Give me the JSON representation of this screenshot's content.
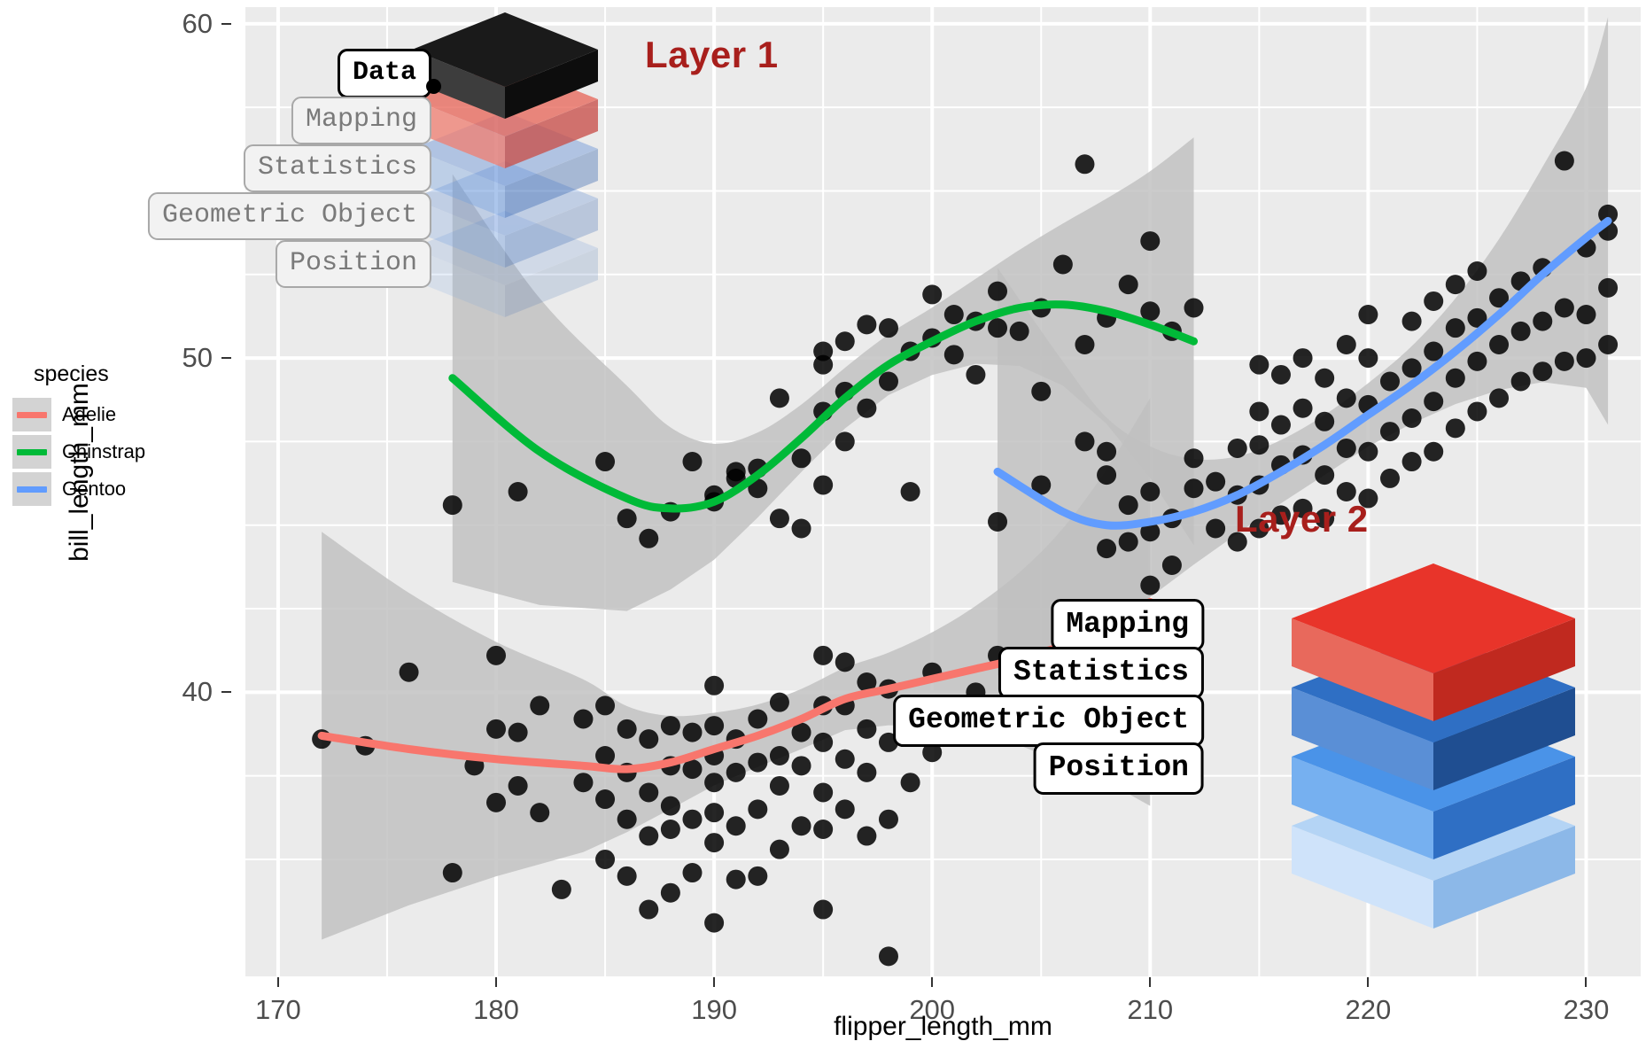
{
  "chart_data": {
    "type": "scatter",
    "title": "",
    "xlabel": "flipper_length_mm",
    "ylabel": "bill_length_mm",
    "xlim": [
      168.5,
      232.5
    ],
    "ylim": [
      31.5,
      60.5
    ],
    "xticks": [
      "170",
      "180",
      "190",
      "200",
      "210",
      "220",
      "230"
    ],
    "xtick_values": [
      170,
      180,
      190,
      200,
      210,
      220,
      230
    ],
    "yticks": [
      "60",
      "50",
      "40"
    ],
    "ytick_values": [
      60,
      50,
      40
    ],
    "grid": true,
    "panel_background": "#ebebeb",
    "grid_color": "#ffffff",
    "point_color": "#000000",
    "point_alpha": 0.85,
    "se_band_color": "#bfbfbf",
    "legend_title": "species",
    "legend_position": "left",
    "series": [
      {
        "name": "Adelie",
        "color": "#f8766d",
        "smooth_x": [
          172,
          176,
          180,
          184,
          186,
          188,
          190,
          192,
          194,
          196,
          198,
          200,
          202,
          204,
          206,
          208,
          210
        ],
        "smooth_y": [
          38.7,
          38.3,
          38.0,
          37.8,
          37.7,
          37.9,
          38.3,
          38.7,
          39.2,
          39.8,
          40.1,
          40.4,
          40.7,
          41.0,
          41.4,
          42.0,
          42.7
        ],
        "points": [
          [
            172,
            38.6
          ],
          [
            174,
            38.4
          ],
          [
            176,
            40.6
          ],
          [
            178,
            34.6
          ],
          [
            179,
            37.8
          ],
          [
            180,
            36.7
          ],
          [
            180,
            38.9
          ],
          [
            180,
            41.1
          ],
          [
            181,
            37.2
          ],
          [
            181,
            38.8
          ],
          [
            182,
            36.4
          ],
          [
            182,
            39.6
          ],
          [
            183,
            34.1
          ],
          [
            184,
            37.3
          ],
          [
            184,
            39.2
          ],
          [
            185,
            35.0
          ],
          [
            185,
            36.8
          ],
          [
            185,
            38.1
          ],
          [
            185,
            39.6
          ],
          [
            186,
            34.5
          ],
          [
            186,
            36.2
          ],
          [
            186,
            37.6
          ],
          [
            186,
            38.9
          ],
          [
            187,
            33.5
          ],
          [
            187,
            35.7
          ],
          [
            187,
            37.0
          ],
          [
            187,
            38.6
          ],
          [
            188,
            34.0
          ],
          [
            188,
            35.9
          ],
          [
            188,
            36.6
          ],
          [
            188,
            37.8
          ],
          [
            188,
            39.0
          ],
          [
            189,
            34.6
          ],
          [
            189,
            36.2
          ],
          [
            189,
            37.7
          ],
          [
            189,
            38.8
          ],
          [
            190,
            33.1
          ],
          [
            190,
            35.5
          ],
          [
            190,
            36.4
          ],
          [
            190,
            37.3
          ],
          [
            190,
            38.1
          ],
          [
            190,
            39.0
          ],
          [
            190,
            40.2
          ],
          [
            191,
            34.4
          ],
          [
            191,
            36.0
          ],
          [
            191,
            37.6
          ],
          [
            191,
            38.6
          ],
          [
            192,
            34.5
          ],
          [
            192,
            36.5
          ],
          [
            192,
            37.9
          ],
          [
            192,
            39.2
          ],
          [
            193,
            35.3
          ],
          [
            193,
            37.2
          ],
          [
            193,
            38.1
          ],
          [
            193,
            39.7
          ],
          [
            194,
            36.0
          ],
          [
            194,
            37.8
          ],
          [
            194,
            38.8
          ],
          [
            195,
            33.5
          ],
          [
            195,
            35.9
          ],
          [
            195,
            37.0
          ],
          [
            195,
            38.5
          ],
          [
            195,
            39.6
          ],
          [
            195,
            41.1
          ],
          [
            196,
            36.5
          ],
          [
            196,
            38.0
          ],
          [
            196,
            39.6
          ],
          [
            196,
            40.9
          ],
          [
            197,
            35.7
          ],
          [
            197,
            37.6
          ],
          [
            197,
            38.9
          ],
          [
            197,
            40.3
          ],
          [
            198,
            32.1
          ],
          [
            198,
            36.2
          ],
          [
            198,
            38.5
          ],
          [
            198,
            40.1
          ],
          [
            199,
            37.3
          ],
          [
            199,
            39.1
          ],
          [
            200,
            38.2
          ],
          [
            200,
            40.6
          ],
          [
            201,
            39.0
          ],
          [
            202,
            40.0
          ],
          [
            203,
            39.3
          ],
          [
            203,
            41.1
          ],
          [
            205,
            39.7
          ],
          [
            206,
            41.3
          ],
          [
            208,
            40.9
          ],
          [
            209,
            41.0
          ],
          [
            210,
            43.2
          ],
          [
            210,
            42.0
          ]
        ]
      },
      {
        "name": "Chinstrap",
        "color": "#00ba38",
        "smooth_x": [
          178,
          182,
          186,
          188,
          190,
          192,
          194,
          196,
          198,
          200,
          202,
          204,
          206,
          208,
          210,
          212
        ],
        "smooth_y": [
          49.4,
          47.2,
          45.8,
          45.5,
          45.7,
          46.5,
          47.6,
          48.8,
          49.8,
          50.5,
          51.1,
          51.5,
          51.6,
          51.4,
          51.0,
          50.5
        ],
        "points": [
          [
            178,
            45.6
          ],
          [
            181,
            46.0
          ],
          [
            185,
            46.9
          ],
          [
            186,
            45.2
          ],
          [
            187,
            44.6
          ],
          [
            188,
            45.4
          ],
          [
            189,
            46.9
          ],
          [
            190,
            45.7
          ],
          [
            190,
            45.9
          ],
          [
            191,
            46.6
          ],
          [
            191,
            46.4
          ],
          [
            192,
            46.1
          ],
          [
            192,
            46.7
          ],
          [
            193,
            45.2
          ],
          [
            193,
            48.8
          ],
          [
            194,
            44.9
          ],
          [
            194,
            47.0
          ],
          [
            195,
            46.2
          ],
          [
            195,
            48.4
          ],
          [
            195,
            49.8
          ],
          [
            195,
            50.2
          ],
          [
            196,
            47.5
          ],
          [
            196,
            49.0
          ],
          [
            196,
            50.5
          ],
          [
            197,
            51.0
          ],
          [
            197,
            48.5
          ],
          [
            198,
            49.3
          ],
          [
            198,
            50.9
          ],
          [
            199,
            46.0
          ],
          [
            199,
            50.2
          ],
          [
            200,
            50.6
          ],
          [
            200,
            51.9
          ],
          [
            201,
            50.1
          ],
          [
            201,
            51.3
          ],
          [
            202,
            49.5
          ],
          [
            202,
            51.1
          ],
          [
            203,
            50.9
          ],
          [
            203,
            52.0
          ],
          [
            204,
            50.8
          ],
          [
            205,
            51.5
          ],
          [
            205,
            49.0
          ],
          [
            206,
            52.8
          ],
          [
            207,
            55.8
          ],
          [
            207,
            50.4
          ],
          [
            208,
            51.2
          ],
          [
            209,
            52.2
          ],
          [
            210,
            51.4
          ],
          [
            210,
            53.5
          ],
          [
            211,
            50.8
          ],
          [
            212,
            51.5
          ]
        ]
      },
      {
        "name": "Gentoo",
        "color": "#619cff",
        "smooth_x": [
          203,
          206,
          208,
          210,
          212,
          214,
          216,
          218,
          220,
          222,
          224,
          226,
          228,
          230,
          231
        ],
        "smooth_y": [
          46.6,
          45.4,
          45.0,
          45.1,
          45.4,
          45.9,
          46.6,
          47.4,
          48.3,
          49.2,
          50.2,
          51.3,
          52.5,
          53.6,
          54.1
        ],
        "points": [
          [
            203,
            45.1
          ],
          [
            205,
            46.2
          ],
          [
            207,
            47.5
          ],
          [
            208,
            44.3
          ],
          [
            208,
            46.5
          ],
          [
            208,
            47.2
          ],
          [
            209,
            44.5
          ],
          [
            209,
            45.6
          ],
          [
            210,
            44.8
          ],
          [
            210,
            46.0
          ],
          [
            211,
            43.8
          ],
          [
            211,
            45.2
          ],
          [
            212,
            46.1
          ],
          [
            212,
            47.0
          ],
          [
            213,
            44.9
          ],
          [
            213,
            46.3
          ],
          [
            214,
            44.5
          ],
          [
            214,
            45.9
          ],
          [
            214,
            47.3
          ],
          [
            215,
            44.9
          ],
          [
            215,
            46.2
          ],
          [
            215,
            47.4
          ],
          [
            215,
            48.4
          ],
          [
            215,
            49.8
          ],
          [
            216,
            45.3
          ],
          [
            216,
            46.8
          ],
          [
            216,
            48.0
          ],
          [
            216,
            49.5
          ],
          [
            217,
            45.5
          ],
          [
            217,
            47.1
          ],
          [
            217,
            48.5
          ],
          [
            217,
            50.0
          ],
          [
            218,
            45.2
          ],
          [
            218,
            46.5
          ],
          [
            218,
            48.1
          ],
          [
            218,
            49.4
          ],
          [
            219,
            46.0
          ],
          [
            219,
            47.3
          ],
          [
            219,
            48.8
          ],
          [
            219,
            50.4
          ],
          [
            220,
            45.8
          ],
          [
            220,
            47.2
          ],
          [
            220,
            48.6
          ],
          [
            220,
            50.0
          ],
          [
            220,
            51.3
          ],
          [
            221,
            46.4
          ],
          [
            221,
            47.8
          ],
          [
            221,
            49.3
          ],
          [
            222,
            46.9
          ],
          [
            222,
            48.2
          ],
          [
            222,
            49.7
          ],
          [
            222,
            51.1
          ],
          [
            223,
            47.2
          ],
          [
            223,
            48.7
          ],
          [
            223,
            50.2
          ],
          [
            223,
            51.7
          ],
          [
            224,
            47.9
          ],
          [
            224,
            49.4
          ],
          [
            224,
            50.9
          ],
          [
            224,
            52.2
          ],
          [
            225,
            48.4
          ],
          [
            225,
            49.9
          ],
          [
            225,
            51.2
          ],
          [
            225,
            52.6
          ],
          [
            226,
            48.8
          ],
          [
            226,
            50.4
          ],
          [
            226,
            51.8
          ],
          [
            227,
            49.3
          ],
          [
            227,
            50.8
          ],
          [
            227,
            52.3
          ],
          [
            228,
            49.6
          ],
          [
            228,
            51.1
          ],
          [
            228,
            52.7
          ],
          [
            229,
            49.9
          ],
          [
            229,
            51.5
          ],
          [
            229,
            55.9
          ],
          [
            230,
            50.0
          ],
          [
            230,
            51.3
          ],
          [
            230,
            53.3
          ],
          [
            231,
            50.4
          ],
          [
            231,
            52.1
          ],
          [
            231,
            53.8
          ],
          [
            231,
            54.3
          ]
        ]
      }
    ]
  },
  "axes": {
    "x_title": "flipper_length_mm",
    "y_title": "bill_length_mm",
    "x_tick_labels": [
      "170",
      "180",
      "190",
      "200",
      "210",
      "220",
      "230"
    ],
    "y_tick_labels": [
      "60",
      "50",
      "40"
    ]
  },
  "legend": {
    "title": "species",
    "items": [
      {
        "label": "Adelie",
        "color": "#f8766d"
      },
      {
        "label": "Chinstrap",
        "color": "#00ba38"
      },
      {
        "label": "Gentoo",
        "color": "#619cff"
      }
    ]
  },
  "annotations": {
    "accent_color": "#a81f1c",
    "layer1": {
      "title": "Layer 1",
      "labels": [
        {
          "text": "Data",
          "style": "strong"
        },
        {
          "text": "Mapping",
          "style": "faint"
        },
        {
          "text": "Statistics",
          "style": "faint"
        },
        {
          "text": "Geometric Object",
          "style": "faint"
        },
        {
          "text": "Position",
          "style": "faint"
        }
      ],
      "slab_colors": [
        {
          "top": "#1a1a1a",
          "left": "#3d3d3d",
          "right": "#0d0d0d",
          "opacity": 1.0
        },
        {
          "top": "#e8695c",
          "left": "#ef8175",
          "right": "#c9504a",
          "opacity": 0.78
        },
        {
          "top": "#4a7fd4",
          "left": "#6f9ee0",
          "right": "#2e5fae",
          "opacity": 0.36
        },
        {
          "top": "#4a7fd4",
          "left": "#6f9ee0",
          "right": "#2e5fae",
          "opacity": 0.26
        },
        {
          "top": "#4a7fd4",
          "left": "#6f9ee0",
          "right": "#2e5fae",
          "opacity": 0.16
        }
      ]
    },
    "layer2": {
      "title": "Layer 2",
      "labels": [
        {
          "text": "Mapping",
          "style": "strong"
        },
        {
          "text": "Statistics",
          "style": "strong"
        },
        {
          "text": "Geometric Object",
          "style": "strong"
        },
        {
          "text": "Position",
          "style": "strong"
        }
      ],
      "slab_colors": [
        {
          "top": "#e8342a",
          "left": "#e8695c",
          "right": "#c0291f",
          "opacity": 1.0
        },
        {
          "top": "#2f6fc4",
          "left": "#5a8fd6",
          "right": "#1f4e91",
          "opacity": 1.0
        },
        {
          "top": "#4a93e8",
          "left": "#76b0f0",
          "right": "#2f6fc4",
          "opacity": 1.0
        },
        {
          "top": "#b4d4f5",
          "left": "#cfe3fa",
          "right": "#8cb8e8",
          "opacity": 1.0
        }
      ]
    }
  }
}
